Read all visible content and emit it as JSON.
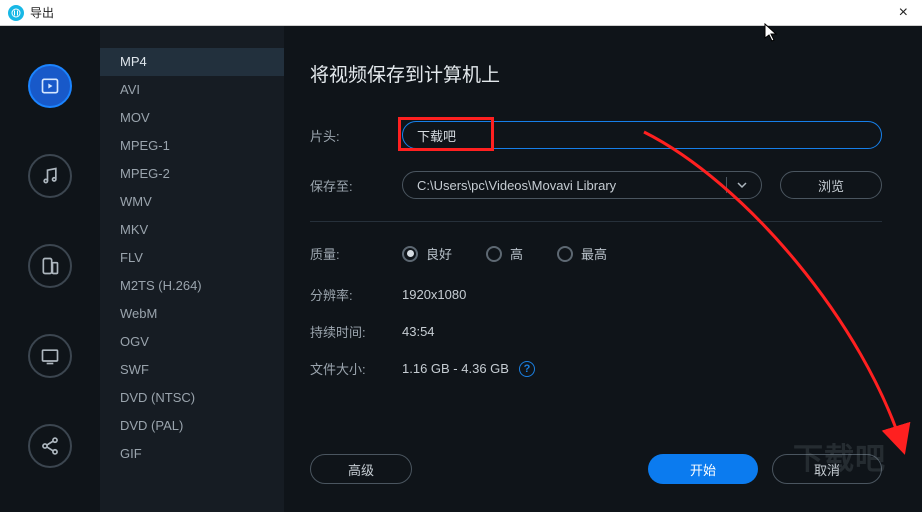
{
  "window": {
    "title": "导出"
  },
  "icon_tabs": [
    "video",
    "audio",
    "device",
    "tv",
    "share"
  ],
  "formats": [
    "MP4",
    "AVI",
    "MOV",
    "MPEG-1",
    "MPEG-2",
    "WMV",
    "MKV",
    "FLV",
    "M2TS (H.264)",
    "WebM",
    "OGV",
    "SWF",
    "DVD (NTSC)",
    "DVD (PAL)",
    "GIF"
  ],
  "selected_format_index": 0,
  "heading": "将视频保存到计算机上",
  "labels": {
    "title": "片头:",
    "save_to": "保存至:",
    "quality": "质量:",
    "resolution": "分辨率:",
    "duration": "持续时间:",
    "filesize": "文件大小:"
  },
  "title_input": {
    "value": "下载吧"
  },
  "save_path": {
    "value": "C:\\Users\\pc\\Videos\\Movavi Library"
  },
  "browse_label": "浏览",
  "quality_options": [
    "良好",
    "高",
    "最高"
  ],
  "quality_selected_index": 0,
  "info": {
    "resolution": "1920x1080",
    "duration": "43:54",
    "filesize": "1.16 GB - 4.36 GB"
  },
  "buttons": {
    "advanced": "高级",
    "start": "开始",
    "cancel": "取消"
  },
  "watermark": "下载吧"
}
